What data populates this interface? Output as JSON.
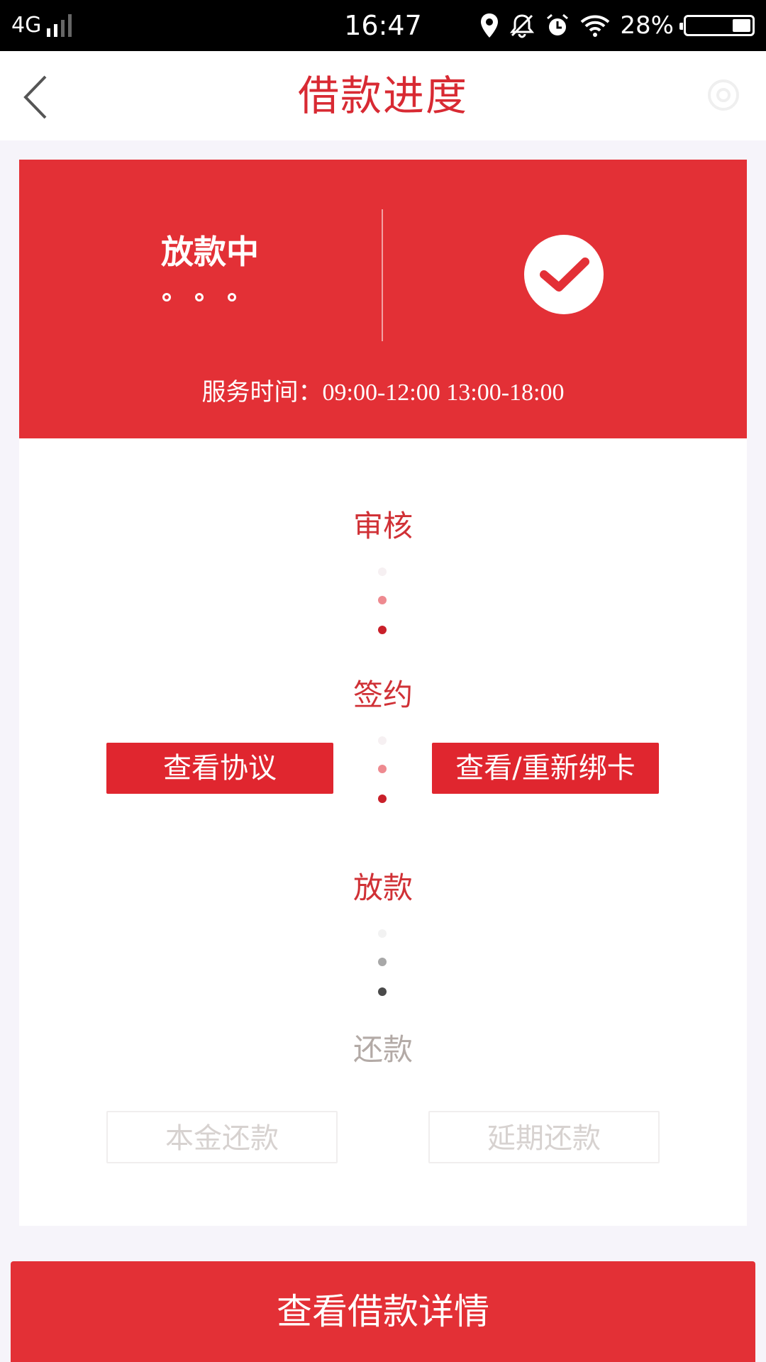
{
  "status_bar": {
    "network": "4G",
    "time": "16:47",
    "battery_percent": "28%",
    "battery_level": 0.28,
    "icons": [
      "signal-icon",
      "location-icon",
      "mute-bell-icon",
      "alarm-icon",
      "wifi-icon",
      "battery-icon"
    ]
  },
  "header": {
    "title": "借款进度",
    "back_icon": "chevron-left-icon",
    "settings_icon": "gear-icon"
  },
  "status_card": {
    "status": "放款中",
    "service_hours": "服务时间：09:00-12:00 13:00-18:00",
    "check_icon": "check-circle-icon",
    "colors": {
      "background": "#e33036",
      "check": "#e33036"
    }
  },
  "steps": [
    {
      "label": "审核",
      "state": "done"
    },
    {
      "label": "签约",
      "state": "done"
    },
    {
      "label": "放款",
      "state": "current"
    },
    {
      "label": "还款",
      "state": "pending"
    }
  ],
  "sign_actions": {
    "view_agreement": "查看协议",
    "rebind_card": "查看/重新绑卡"
  },
  "repay_actions": {
    "principal": "本金还款",
    "extend": "延期还款"
  },
  "bottom_button": {
    "label": "查看借款详情"
  },
  "colors": {
    "accent": "#e33036",
    "active_text": "#d03136",
    "inactive_text": "#b3aaa6"
  }
}
